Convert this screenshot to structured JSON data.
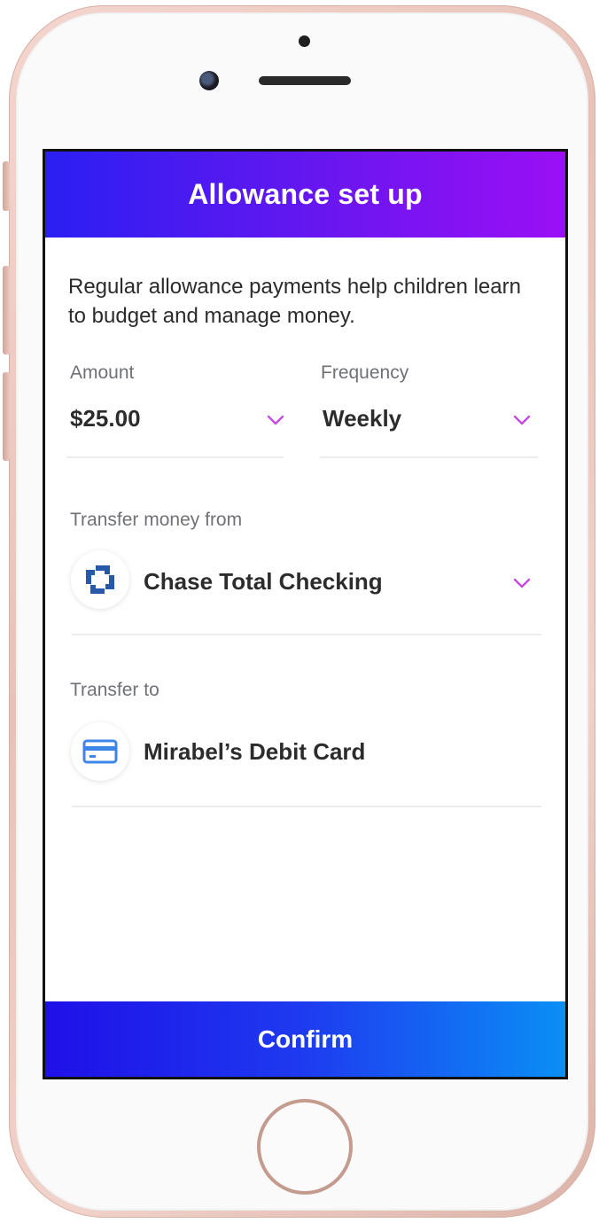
{
  "header": {
    "title": "Allowance set up"
  },
  "intro_text": "Regular allowance payments help children learn to budget and manage money.",
  "amount": {
    "label": "Amount",
    "value": "$25.00"
  },
  "frequency": {
    "label": "Frequency",
    "value": "Weekly"
  },
  "transfer_from": {
    "label": "Transfer money from",
    "account": "Chase Total Checking",
    "icon": "chase-logo-icon"
  },
  "transfer_to": {
    "label": "Transfer to",
    "account": "Mirabel’s Debit Card",
    "icon": "credit-card-icon"
  },
  "confirm": {
    "label": "Confirm"
  },
  "colors": {
    "header_gradient_start": "#2a1ff2",
    "header_gradient_end": "#9b0ff5",
    "confirm_gradient_start": "#1f10e8",
    "confirm_gradient_end": "#0a8ff5",
    "chevron": "#c64be0",
    "chase_blue": "#2a58a8",
    "card_blue": "#3d86e8"
  }
}
